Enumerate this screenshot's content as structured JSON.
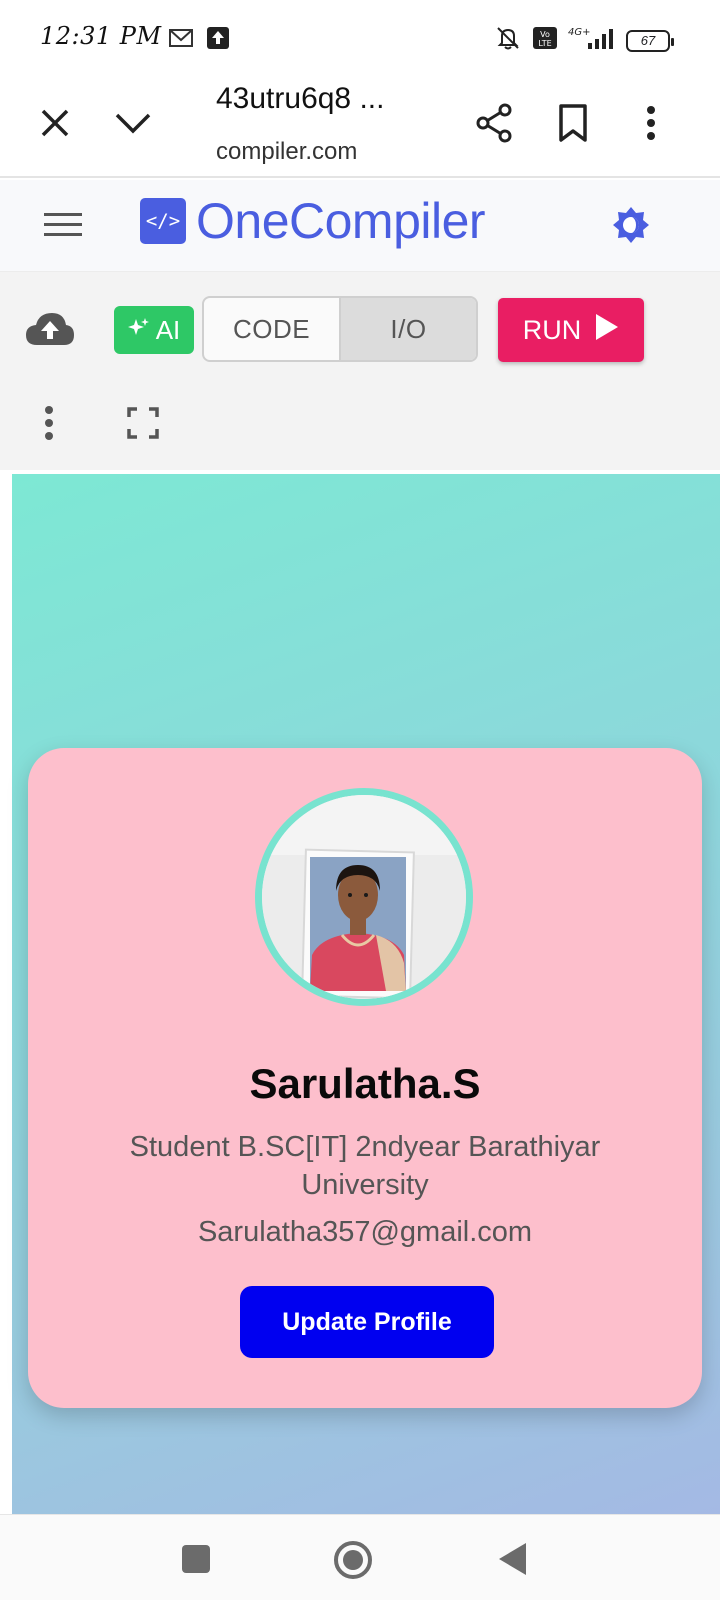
{
  "status_bar": {
    "time": "12:31 PM",
    "battery": "67",
    "icons": [
      "mail-icon",
      "upload-icon",
      "bell-muted-icon",
      "volte-icon",
      "signal-4g-icon",
      "battery-icon"
    ]
  },
  "browser": {
    "tab_title": "43utru6q8 ...",
    "url": "compiler.com"
  },
  "header": {
    "logo_symbol": "</>",
    "logo_text": "OneCompiler"
  },
  "toolbar": {
    "ai_label": "AI",
    "code_label": "CODE",
    "io_label": "I/O",
    "run_label": "RUN",
    "active_segment": "I/O"
  },
  "profile_card": {
    "name": "Sarulatha.S",
    "description": "Student B.SC[IT] 2ndyear Barathiyar University",
    "email": "Sarulatha357@gmail.com",
    "button_label": "Update Profile"
  },
  "colors": {
    "brand": "#4a5ee0",
    "ai_green": "#2ec866",
    "run_pink": "#e91e63",
    "card_pink": "#fdbfcc",
    "ring_teal": "#78e3cf",
    "update_blue": "#0000f0"
  }
}
